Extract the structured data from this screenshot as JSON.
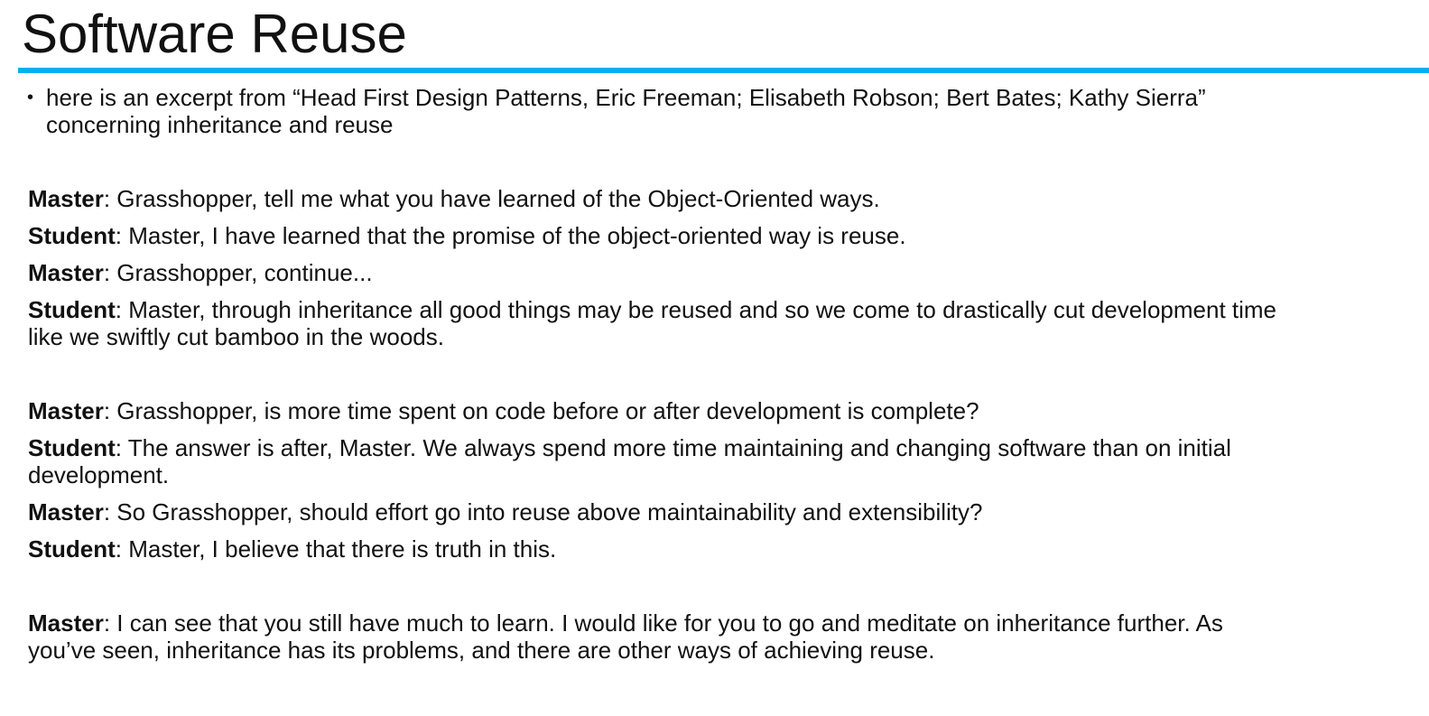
{
  "slide": {
    "title": "Software Reuse",
    "accent_color": "#00b0f0",
    "bullet": {
      "line1": "here is an excerpt from “Head First Design Patterns, Eric Freeman; Elisabeth Robson; Bert Bates; Kathy Sierra”",
      "line2": "concerning inheritance and reuse"
    },
    "dialogue": [
      {
        "speaker": "Master",
        "line1": ": Grasshopper, tell me what you have learned of the Object-Oriented ways.",
        "line2": ""
      },
      {
        "speaker": "Student",
        "line1": ": Master, I have learned that the promise of the object-oriented way is reuse.",
        "line2": ""
      },
      {
        "speaker": "Master",
        "line1": ": Grasshopper, continue...",
        "line2": ""
      },
      {
        "speaker": "Student",
        "line1": ": Master, through inheritance all good things may be reused and so we come to drastically cut development time",
        "line2": "like we swiftly cut bamboo in the woods."
      },
      {
        "speaker": "Master",
        "line1": ": Grasshopper, is more time spent on code before or after development is complete?",
        "line2": ""
      },
      {
        "speaker": "Student",
        "line1": ": The answer is after, Master. We always spend more time maintaining and changing software than on initial",
        "line2": "development."
      },
      {
        "speaker": "Master",
        "line1": ": So Grasshopper, should effort go into reuse above maintainability and extensibility?",
        "line2": ""
      },
      {
        "speaker": "Student",
        "line1": ": Master, I believe that there is truth in this.",
        "line2": ""
      },
      {
        "speaker": "Master",
        "line1": ": I can see that you still have much to learn. I would like for you to go and meditate on inheritance further. As",
        "line2": "you’ve seen, inheritance has its problems, and there are other ways of achieving reuse."
      }
    ]
  }
}
